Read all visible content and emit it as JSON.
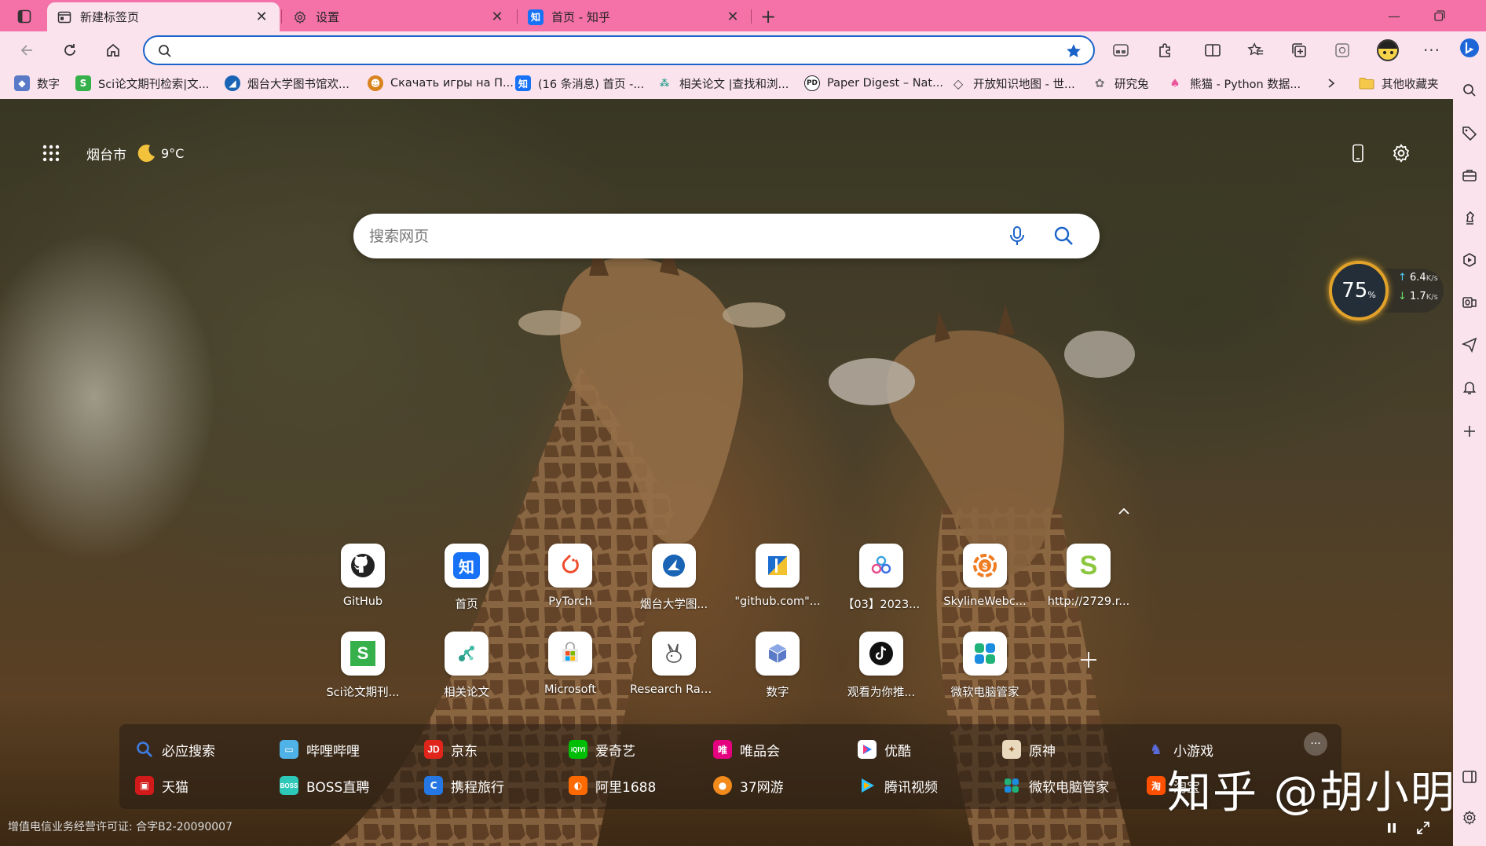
{
  "tabs": [
    {
      "title": "新建标签页",
      "icon": "new-tab-page-icon",
      "active": true
    },
    {
      "title": "设置",
      "icon": "gear-icon",
      "active": false
    },
    {
      "title": "首页 - 知乎",
      "icon": "zhihu-icon",
      "active": false
    }
  ],
  "address": {
    "value": "",
    "placeholder": ""
  },
  "bookmarks": [
    {
      "label": "数字",
      "icon": "cube-icon",
      "color": "#5a7ac8"
    },
    {
      "label": "Sci论文期刊检索|文...",
      "icon": "sci-s-icon",
      "color": "#35b04a"
    },
    {
      "label": "烟台大学图书馆欢...",
      "icon": "library-icon",
      "color": "#1a64b5"
    },
    {
      "label": "Скачать игры на П...",
      "icon": "game-icon",
      "color": "#d9831f"
    },
    {
      "label": "(16 条消息) 首页 -...",
      "icon": "zhihu-icon",
      "color": "#1772f6"
    },
    {
      "label": "相关论文 |查找和浏...",
      "icon": "connected-papers-icon",
      "color": "#2a9f8a"
    },
    {
      "label": "Paper Digest – Nat...",
      "icon": "paper-digest-icon",
      "color": "#222222"
    },
    {
      "label": "开放知识地图 - 世...",
      "icon": "diamond-icon",
      "color": "#444444"
    },
    {
      "label": "研究兔",
      "icon": "rabbit-icon",
      "color": "#888888"
    },
    {
      "label": "熊猫 - Python 数据...",
      "icon": "panda-icon",
      "color": "#e8579a"
    }
  ],
  "other_favorites": "其他收藏夹",
  "weather": {
    "city": "烟台市",
    "temp": "9°C"
  },
  "search": {
    "placeholder": "搜索网页"
  },
  "speed_widget": {
    "percent": "75",
    "percent_unit": "%",
    "up": "6.4",
    "down": "1.7",
    "unit": "K/s"
  },
  "quick_links": [
    {
      "label": "GitHub",
      "icon": "github-icon",
      "color": "#222222"
    },
    {
      "label": "首页",
      "icon": "zhihu-icon",
      "color": "#1772f6"
    },
    {
      "label": "PyTorch",
      "icon": "pytorch-icon",
      "color": "#ee4c2c"
    },
    {
      "label": "烟台大学图...",
      "icon": "library-icon",
      "color": "#1a64b5"
    },
    {
      "label": "\"github.com\"...",
      "icon": "github-com-icon",
      "color": "#1c6dd0"
    },
    {
      "label": "【03】2023...",
      "icon": "cluster-icon",
      "color": "#3aa3e3"
    },
    {
      "label": "SkylineWebc...",
      "icon": "skyline-icon",
      "color": "#f07c22"
    },
    {
      "label": "http://2729.r...",
      "icon": "s-letter-icon",
      "color": "#8cc63f"
    },
    {
      "label": "Sci论文期刊...",
      "icon": "sci-s-icon",
      "color": "#35b04a"
    },
    {
      "label": "相关论文",
      "icon": "connected-papers-icon",
      "color": "#2a9f8a"
    },
    {
      "label": "Microsoft",
      "icon": "microsoft-store-icon",
      "color": "#f2b01e"
    },
    {
      "label": "Research Rab...",
      "icon": "rabbit-icon",
      "color": "#555555"
    },
    {
      "label": "数字",
      "icon": "cube-icon",
      "color": "#5a7ac8"
    },
    {
      "label": "观看为你推...",
      "icon": "tiktok-icon",
      "color": "#111111"
    },
    {
      "label": "微软电脑管家",
      "icon": "pc-manager-icon",
      "color": "#1fb37a"
    }
  ],
  "bottom_links": [
    {
      "label": "必应搜索",
      "icon": "search-icon",
      "color": "#3d7ce0"
    },
    {
      "label": "哔哩哔哩",
      "icon": "bilibili-icon",
      "color": "#4fb3e8"
    },
    {
      "label": "京东",
      "icon": "jd-icon",
      "color": "#e1251b"
    },
    {
      "label": "爱奇艺",
      "icon": "iqiyi-icon",
      "color": "#00be06"
    },
    {
      "label": "唯品会",
      "icon": "vip-icon",
      "color": "#e4007f"
    },
    {
      "label": "优酷",
      "icon": "youku-icon",
      "color": "#2a7bff"
    },
    {
      "label": "原神",
      "icon": "genshin-icon",
      "color": "#c9a45e"
    },
    {
      "label": "小游戏",
      "icon": "mini-game-icon",
      "color": "#5b6ee1"
    },
    {
      "label": "天猫",
      "icon": "tmall-icon",
      "color": "#d21a1a"
    },
    {
      "label": "BOSS直聘",
      "icon": "boss-icon",
      "color": "#2ec8b8"
    },
    {
      "label": "携程旅行",
      "icon": "ctrip-icon",
      "color": "#2577e3"
    },
    {
      "label": "阿里1688",
      "icon": "ali1688-icon",
      "color": "#ff6a00"
    },
    {
      "label": "37网游",
      "icon": "game37-icon",
      "color": "#f28a1c"
    },
    {
      "label": "腾讯视频",
      "icon": "tencent-video-icon",
      "color": "#2dc3ff"
    },
    {
      "label": "微软电脑管家",
      "icon": "pc-manager-icon",
      "color": "#1fb37a"
    },
    {
      "label": "淘宝",
      "icon": "taobao-icon",
      "color": "#ff5000"
    }
  ],
  "license": "增值电信业务经营许可证: 合字B2-20090007",
  "watermark": "知乎 @胡小明",
  "colors": {
    "tabstrip": "#f472a8",
    "toolbar": "#fbe3ee",
    "accent": "#1a63c9"
  }
}
